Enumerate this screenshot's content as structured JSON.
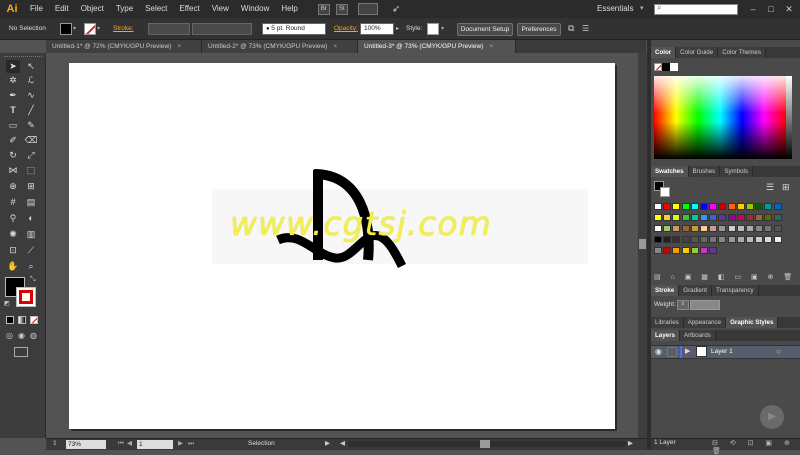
{
  "app": {
    "logo": "Ai",
    "workspace": "Essentials",
    "search_icon": "magnifier-icon"
  },
  "menu": [
    "File",
    "Edit",
    "Object",
    "Type",
    "Select",
    "Effect",
    "View",
    "Window",
    "Help"
  ],
  "bridge_buttons": [
    "Br",
    "St"
  ],
  "control_bar": {
    "selection_status": "No Selection",
    "stroke_label": "Stroke:",
    "stroke_profile": "5 pt. Round",
    "opacity_label": "Opacity:",
    "opacity_value": "100%",
    "style_label": "Style:",
    "document_setup": "Document Setup",
    "preferences": "Preferences"
  },
  "tabs": [
    {
      "label": "Untitled-1* @ 72% (CMYK/GPU Preview)",
      "close": "×"
    },
    {
      "label": "Untitled-2* @ 73% (CMYK/GPU Preview)",
      "close": "×"
    },
    {
      "label": "Untitled-3* @ 73% (CMYK/GPU Preview)",
      "close": "×"
    }
  ],
  "canvas": {
    "watermark": "www.cgtsj.com"
  },
  "status_bar": {
    "zoom": "73%",
    "artboard": "1",
    "tool": "Selection"
  },
  "panels": {
    "color_tabs": [
      "Color",
      "Color Guide",
      "Color Themes"
    ],
    "swatch_tabs": [
      "Swatches",
      "Brushes",
      "Symbols"
    ],
    "stroke_tabs": [
      "Stroke",
      "Gradient",
      "Transparency"
    ],
    "stroke_weight_label": "Weight:",
    "library_tabs": [
      "Libraries",
      "Appearance",
      "Graphic Styles"
    ],
    "layer_tabs": [
      "Layers",
      "Artboards"
    ],
    "layer_name": "Layer 1",
    "layer_count": "1 Layer"
  },
  "colors": {
    "accent": "#f7a61c",
    "watermark": "#f3f04d",
    "layer_color": "#4a6fff"
  }
}
